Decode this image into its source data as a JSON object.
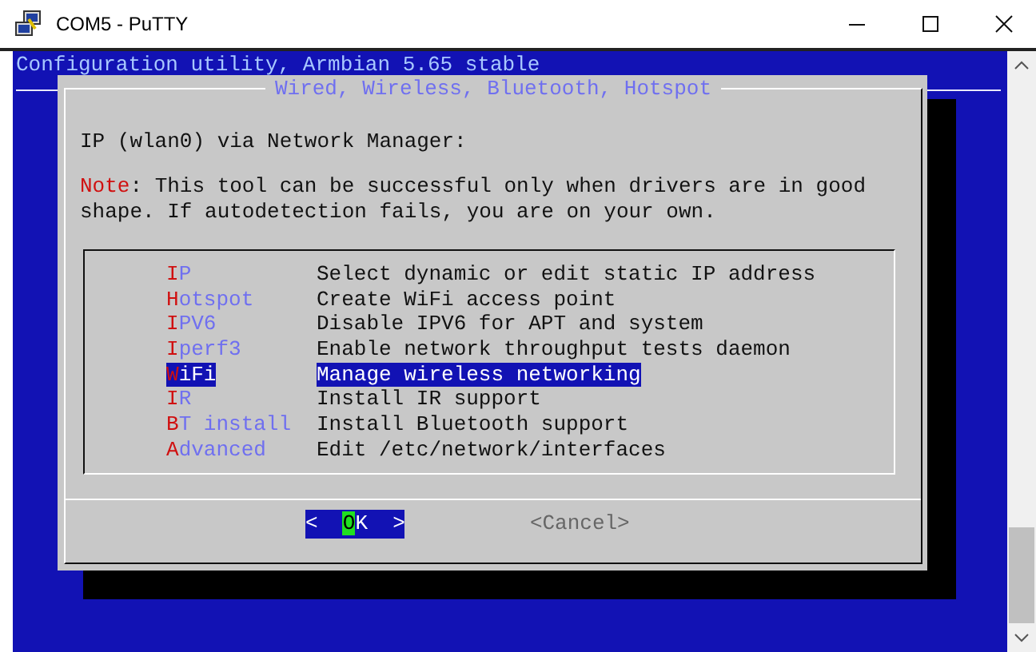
{
  "window": {
    "title": "COM5 - PuTTY"
  },
  "terminal": {
    "header": "Configuration utility, Armbian 5.65 stable"
  },
  "dialog": {
    "title": "Wired, Wireless, Bluetooth, Hotspot",
    "prompt": "IP (wlan0) via Network Manager:",
    "note": {
      "label": "Note",
      "text": ": This tool can be successful only when drivers are in good shape. If autodetection fails, you are on your own."
    },
    "menu": [
      {
        "tag": "IP",
        "description": "Select dynamic or edit static IP address",
        "selected": false
      },
      {
        "tag": "Hotspot",
        "description": "Create WiFi access point",
        "selected": false
      },
      {
        "tag": "IPV6",
        "description": "Disable IPV6 for APT and system",
        "selected": false
      },
      {
        "tag": "Iperf3",
        "description": "Enable network throughput tests daemon",
        "selected": false
      },
      {
        "tag": "WiFi",
        "description": "Manage wireless networking",
        "selected": true
      },
      {
        "tag": "IR",
        "description": "Install IR support",
        "selected": false
      },
      {
        "tag": "BT install",
        "description": "Install Bluetooth support",
        "selected": false
      },
      {
        "tag": "Advanced",
        "description": "Edit /etc/network/interfaces",
        "selected": false
      }
    ],
    "buttons": [
      {
        "before": "<  ",
        "cursor": "O",
        "after": "K  >",
        "selected": true
      },
      {
        "before": "<Cancel>",
        "selected": false
      }
    ]
  }
}
